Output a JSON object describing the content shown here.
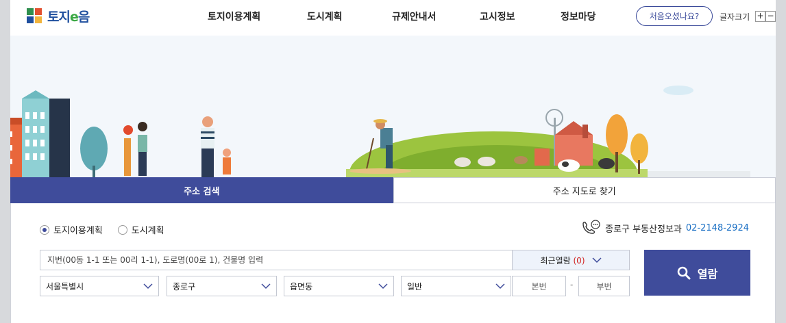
{
  "header": {
    "logo_text_1": "토지",
    "logo_text_e": "e",
    "logo_text_2": "음",
    "nav": [
      "토지이용계획",
      "도시계획",
      "규제안내서",
      "고시정보",
      "정보마당"
    ],
    "first_visit": "처음오셨나요?",
    "font_size_label": "글자크기",
    "font_plus": "+",
    "font_minus": "−"
  },
  "tabs": [
    "주소 검색",
    "주소 지도로 찾기"
  ],
  "search": {
    "radios": [
      "토지이용계획",
      "도시계획"
    ],
    "selected_radio": "토지이용계획",
    "contact_label": "종로구 부동산정보과",
    "contact_phone": "02-2148-2924",
    "placeholder": "지번(00동 1-1 또는 00리 1-1), 도로명(00로 1), 건물명 입력",
    "recent_label": "최근열람",
    "recent_count": "(0)",
    "selects": [
      "서울특별시",
      "종로구",
      "읍면동",
      "일반"
    ],
    "main_number": "본번",
    "sub_number": "부번",
    "dash": "-",
    "view_button": "열람"
  },
  "colors": {
    "primary": "#3f4c9b",
    "accent_phone": "#1a6fc4",
    "recent_count": "#d12020"
  }
}
